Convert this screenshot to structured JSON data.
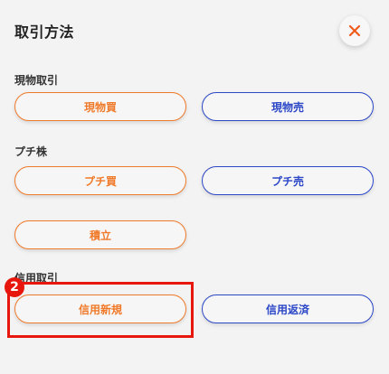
{
  "modal": {
    "title": "取引方法",
    "close_icon": "close-icon",
    "accent_buy": "#f07a2a",
    "accent_sell": "#2c47c7"
  },
  "sections": {
    "genbutsu": {
      "label": "現物取引",
      "buy": "現物買",
      "sell": "現物売"
    },
    "petit": {
      "label": "プチ株",
      "buy": "プチ買",
      "sell": "プチ売"
    },
    "tsumitate": {
      "label": "積立"
    },
    "shinyo": {
      "label": "信用取引",
      "new": "信用新規",
      "close": "信用返済"
    }
  },
  "annotation": {
    "step": "2",
    "color": "#e8170e"
  }
}
